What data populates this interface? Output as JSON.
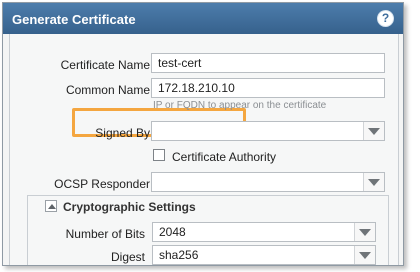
{
  "dialog": {
    "title": "Generate Certificate",
    "help_icon": "help-circle-icon",
    "accent_color": "#3f6e9d"
  },
  "form": {
    "certificate_name": {
      "label": "Certificate Name",
      "value": "test-cert"
    },
    "common_name": {
      "label": "Common Name",
      "value": "172.18.210.10",
      "hint": "IP or FQDN to appear on the certificate",
      "highlight_color": "#f4a640"
    },
    "signed_by": {
      "label": "Signed By",
      "value": ""
    },
    "certificate_authority": {
      "label": "Certificate Authority",
      "checked": false
    },
    "ocsp_responder": {
      "label": "OCSP Responder",
      "value": ""
    }
  },
  "crypto": {
    "title": "Cryptographic Settings",
    "number_of_bits": {
      "label": "Number of Bits",
      "value": "2048"
    },
    "digest": {
      "label": "Digest",
      "value": "sha256"
    }
  }
}
